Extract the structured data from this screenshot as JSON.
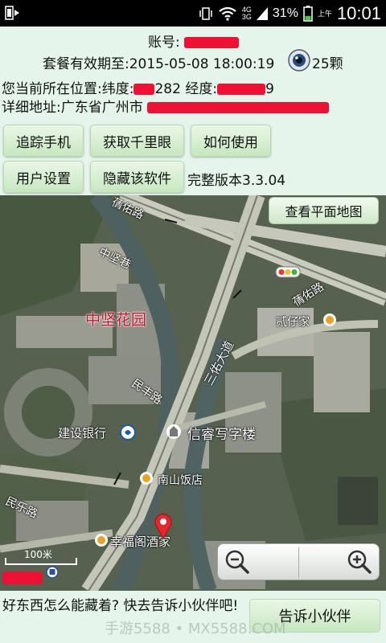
{
  "status": {
    "network": "4G\n3G",
    "battery": "31%",
    "am_pm": "上午",
    "time": "10:01"
  },
  "account": {
    "label": "账号:"
  },
  "plan": {
    "label": "套餐有效期至:2015-05-08 18:00:19",
    "eye_count": "25颗"
  },
  "position": {
    "lat_label": "您当前所在位置:纬度:",
    "lat_suffix": "282",
    "lng_label": " 经度:",
    "lng_suffix": "9"
  },
  "address": {
    "label": "详细地址:广东省广州市"
  },
  "buttons": {
    "track": "追踪手机",
    "eye": "获取千里眼",
    "howto": "如何使用",
    "settings": "用户设置",
    "hide": "隐藏该软件"
  },
  "version": "完整版本3.3.04",
  "map": {
    "plain_button": "查看平面地图",
    "labels": [
      "中坚巷",
      "中坚花园",
      "民丰路",
      "建设银行",
      "信睿写字楼",
      "南山饭店",
      "幸福阁酒家",
      "民乐路",
      "蒨佑路",
      "贰仔家",
      "三佑大道",
      "蒨佑路"
    ],
    "scale": "100米"
  },
  "footer": {
    "prompt": "好东西怎么能藏着? 快去告诉小伙伴吧!",
    "share": "告诉小伙伴",
    "watermark": "手游5588 • MX5588.COM"
  }
}
